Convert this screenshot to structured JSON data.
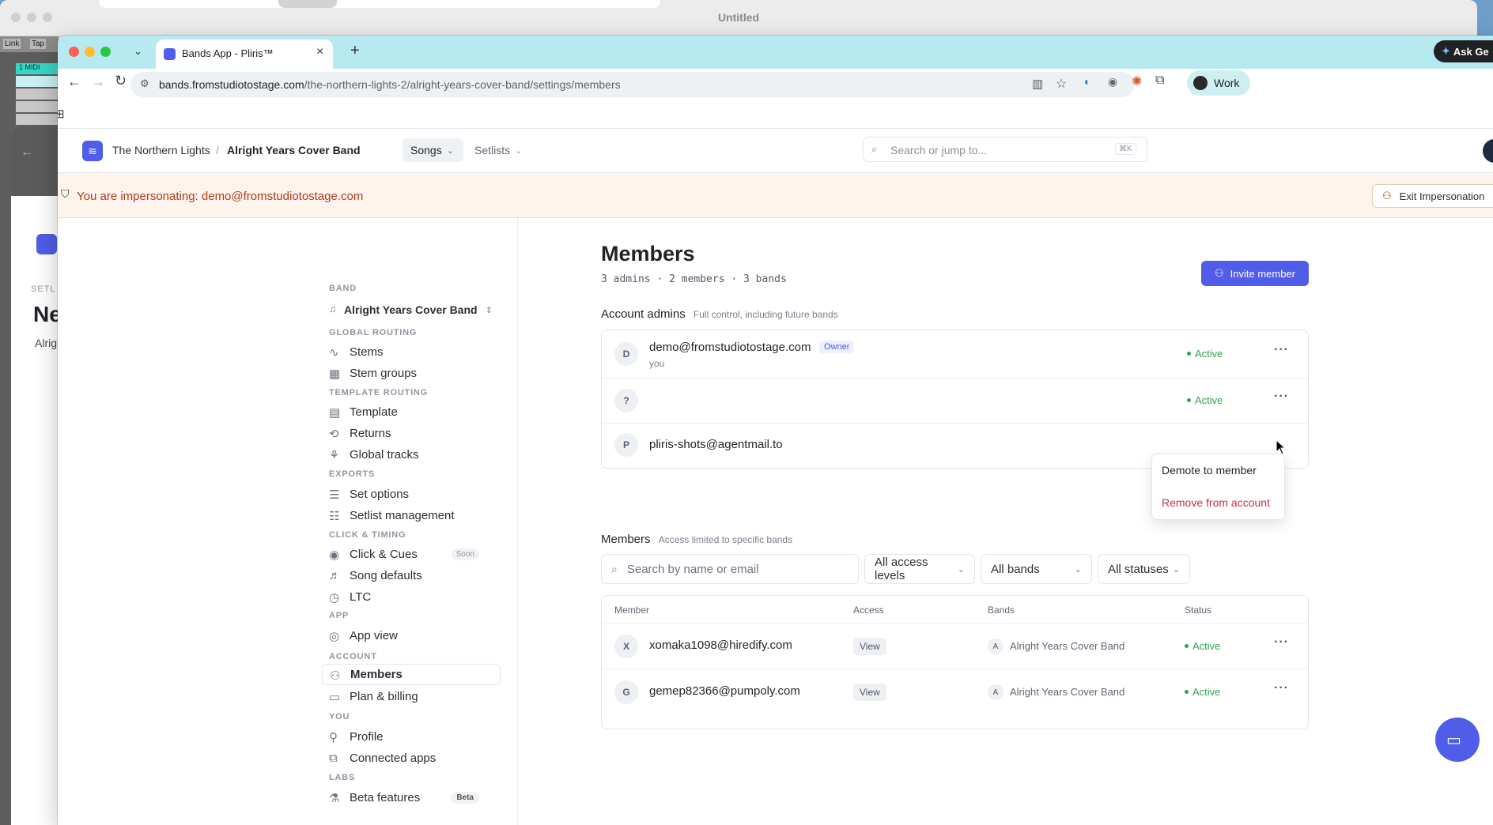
{
  "background_window": {
    "title": "Untitled",
    "daw_buttons": [
      "Link",
      "Tap"
    ],
    "midi_label": "1 MIDI",
    "inner_heading": "Ne",
    "inner_sub": "Alrigl",
    "inner_label": "SETL"
  },
  "browser": {
    "tab_title": "Bands App - Pliris™",
    "url_host": "bands.fromstudiotostage.com",
    "url_path": "/the-northern-lights-2/alright-years-cover-band/settings/members",
    "ask_label": "Ask Ge",
    "profile_label": "Work"
  },
  "appbar": {
    "org": "The Northern Lights",
    "separator": "/",
    "band": "Alright Years Cover Band",
    "nav_songs": "Songs",
    "nav_setlists": "Setlists",
    "search_placeholder": "Search or jump to...",
    "search_shortcut": "⌘K"
  },
  "banner": {
    "text": "You are impersonating: demo@fromstudiotostage.com",
    "exit_label": "Exit Impersonation"
  },
  "sidebar": {
    "band_section": "BAND",
    "band_name": "Alright Years Cover Band",
    "sections": {
      "global_routing": "GLOBAL ROUTING",
      "template_routing": "TEMPLATE ROUTING",
      "exports": "EXPORTS",
      "click_timing": "CLICK & TIMING",
      "app": "APP",
      "account": "ACCOUNT",
      "you": "YOU",
      "labs": "LABS"
    },
    "items": {
      "stems": "Stems",
      "stem_groups": "Stem groups",
      "template": "Template",
      "returns": "Returns",
      "global_tracks": "Global tracks",
      "set_options": "Set options",
      "setlist_management": "Setlist management",
      "click_cues": "Click & Cues",
      "click_cues_badge": "Soon",
      "song_defaults": "Song defaults",
      "ltc": "LTC",
      "app_view": "App view",
      "members": "Members",
      "plan_billing": "Plan & billing",
      "profile": "Profile",
      "connected_apps": "Connected apps",
      "beta_features": "Beta features",
      "beta_badge": "Beta"
    }
  },
  "main": {
    "title": "Members",
    "summary": "3 admins · 2 members · 3 bands",
    "invite_label": "Invite member",
    "admins_heading": "Account admins",
    "admins_sub": "Full control, including future bands",
    "admins": [
      {
        "initial": "D",
        "email": "demo@fromstudiotostage.com",
        "badge": "Owner",
        "sub": "you",
        "status": "Active"
      },
      {
        "initial": "?",
        "email": "",
        "status": "Active"
      },
      {
        "initial": "P",
        "email": "pliris-shots@agentmail.to"
      }
    ],
    "menu": {
      "demote": "Demote to member",
      "remove": "Remove from account"
    },
    "members_heading": "Members",
    "members_sub": "Access limited to specific bands",
    "search_placeholder": "Search by name or email",
    "filters": {
      "access": "All access levels",
      "bands": "All bands",
      "statuses": "All statuses"
    },
    "table_headers": {
      "member": "Member",
      "access": "Access",
      "bands": "Bands",
      "status": "Status"
    },
    "members": [
      {
        "initial": "X",
        "email": "xomaka1098@hiredify.com",
        "access": "View",
        "band_initial": "A",
        "band": "Alright Years Cover Band",
        "status": "Active"
      },
      {
        "initial": "G",
        "email": "gemep82366@pumpoly.com",
        "access": "View",
        "band_initial": "A",
        "band": "Alright Years Cover Band",
        "status": "Active"
      }
    ]
  },
  "colors": {
    "accent": "#4f5de8",
    "active": "#2fa44f",
    "danger": "#c4314b",
    "banner_text": "#b23a1e",
    "tabstrip": "#b6e9f0"
  }
}
